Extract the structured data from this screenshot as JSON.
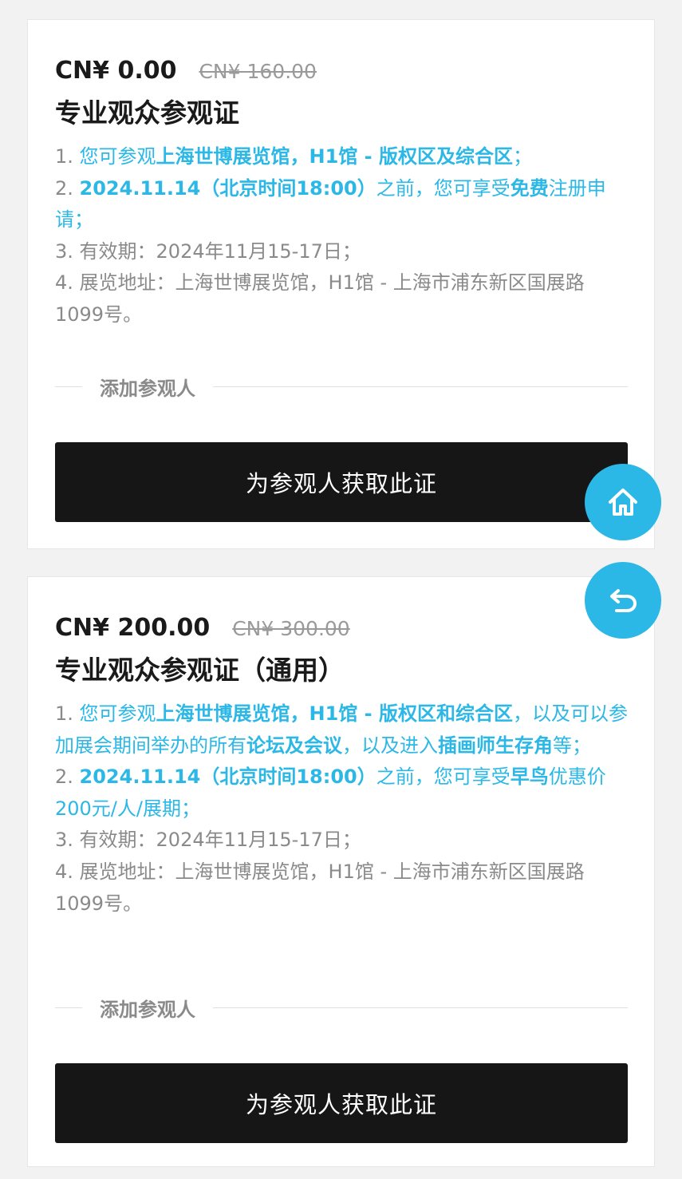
{
  "tickets": [
    {
      "price_now": "CN¥ 0.00",
      "price_old": "CN¥ 160.00",
      "name": "专业观众参观证",
      "lines": [
        [
          {
            "t": "1. ",
            "s": "gray"
          },
          {
            "t": "您可参观",
            "s": "blue"
          },
          {
            "t": "上海世博展览馆，H1馆 - 版权区及综合区",
            "s": "blue-b"
          },
          {
            "t": "；",
            "s": "blue"
          }
        ],
        [
          {
            "t": "2. ",
            "s": "gray"
          },
          {
            "t": "2024.11.14（北京时间18:00）",
            "s": "blue-b"
          },
          {
            "t": "之前，您可享受",
            "s": "blue"
          },
          {
            "t": "免费",
            "s": "blue-b"
          },
          {
            "t": "注册申请；",
            "s": "blue"
          }
        ],
        [
          {
            "t": "3. 有效期：2024年11月15-17日；",
            "s": "gray"
          }
        ],
        [
          {
            "t": "4. 展览地址：上海世博展览馆，H1馆 - 上海市浦东新区国展路1099号。",
            "s": "gray"
          }
        ]
      ],
      "add_visitor_label": "添加参观人",
      "button_label": "为参观人获取此证"
    },
    {
      "price_now": "CN¥ 200.00",
      "price_old": "CN¥ 300.00",
      "name": "专业观众参观证（通用）",
      "lines": [
        [
          {
            "t": "1. ",
            "s": "gray"
          },
          {
            "t": "您可参观",
            "s": "blue"
          },
          {
            "t": "上海世博展览馆，H1馆 - 版权区和综合区",
            "s": "blue-b"
          },
          {
            "t": "，以及可以参加展会期间举办的所有",
            "s": "blue"
          },
          {
            "t": "论坛及会议",
            "s": "blue-b"
          },
          {
            "t": "，以及进入",
            "s": "blue"
          },
          {
            "t": "插画师生存角",
            "s": "blue-b"
          },
          {
            "t": "等；",
            "s": "blue"
          }
        ],
        [
          {
            "t": "2. ",
            "s": "gray"
          },
          {
            "t": "2024.11.14（北京时间18:00）",
            "s": "blue-b"
          },
          {
            "t": "之前，您可享受",
            "s": "blue"
          },
          {
            "t": "早鸟",
            "s": "blue-b"
          },
          {
            "t": "优惠价200元/人/展期；",
            "s": "blue"
          }
        ],
        [
          {
            "t": "3. 有效期：2024年11月15-17日；",
            "s": "gray"
          }
        ],
        [
          {
            "t": "4. 展览地址：上海世博展览馆，H1馆 - 上海市浦东新区国展路1099号。",
            "s": "gray"
          }
        ]
      ],
      "add_visitor_label": "添加参观人",
      "button_label": "为参观人获取此证"
    }
  ],
  "fabs": {
    "home_icon": "home-icon",
    "back_icon": "back-arrow-icon"
  },
  "colors": {
    "accent": "#2bb8e6",
    "button_bg": "#161616",
    "muted_text": "#8a8a8a"
  }
}
